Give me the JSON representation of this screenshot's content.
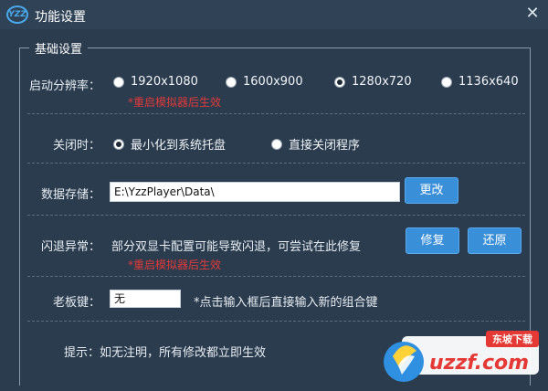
{
  "window": {
    "logo_text": "YZZ",
    "title": "功能设置",
    "close_glyph": "✕"
  },
  "section": {
    "legend": "基础设置"
  },
  "resolution": {
    "label": "启动分辨率：",
    "options": [
      {
        "label": "1920x1080",
        "selected": false
      },
      {
        "label": "1600x900",
        "selected": false
      },
      {
        "label": "1280x720",
        "selected": true
      },
      {
        "label": "1136x640",
        "selected": false
      }
    ],
    "note": "*重启模拟器后生效"
  },
  "close_behavior": {
    "label": "关闭时：",
    "options": [
      {
        "label": "最小化到系统托盘",
        "selected": true
      },
      {
        "label": "直接关闭程序",
        "selected": false
      }
    ]
  },
  "storage": {
    "label": "数据存储：",
    "path_value": "E:\\YzzPlayer\\Data\\",
    "change_button": "更改"
  },
  "crash": {
    "label": "闪退异常：",
    "description": "部分双显卡配置可能导致闪退，可尝试在此修复",
    "repair_button": "修复",
    "restore_button": "还原",
    "note": "*重启模拟器后生效"
  },
  "boss_key": {
    "label": "老板键：",
    "value": "无",
    "hint": "*点击输入框后直接输入新的组合键"
  },
  "footer": {
    "tip": "提示：如无注明，所有修改都立即生效"
  },
  "watermark": {
    "brand": "uzzf.com",
    "badge": "东坡下载"
  },
  "colors": {
    "window_bg": "#2b3c4e",
    "accent_blue": "#3a8fd9",
    "note_red": "#e03a3a"
  }
}
